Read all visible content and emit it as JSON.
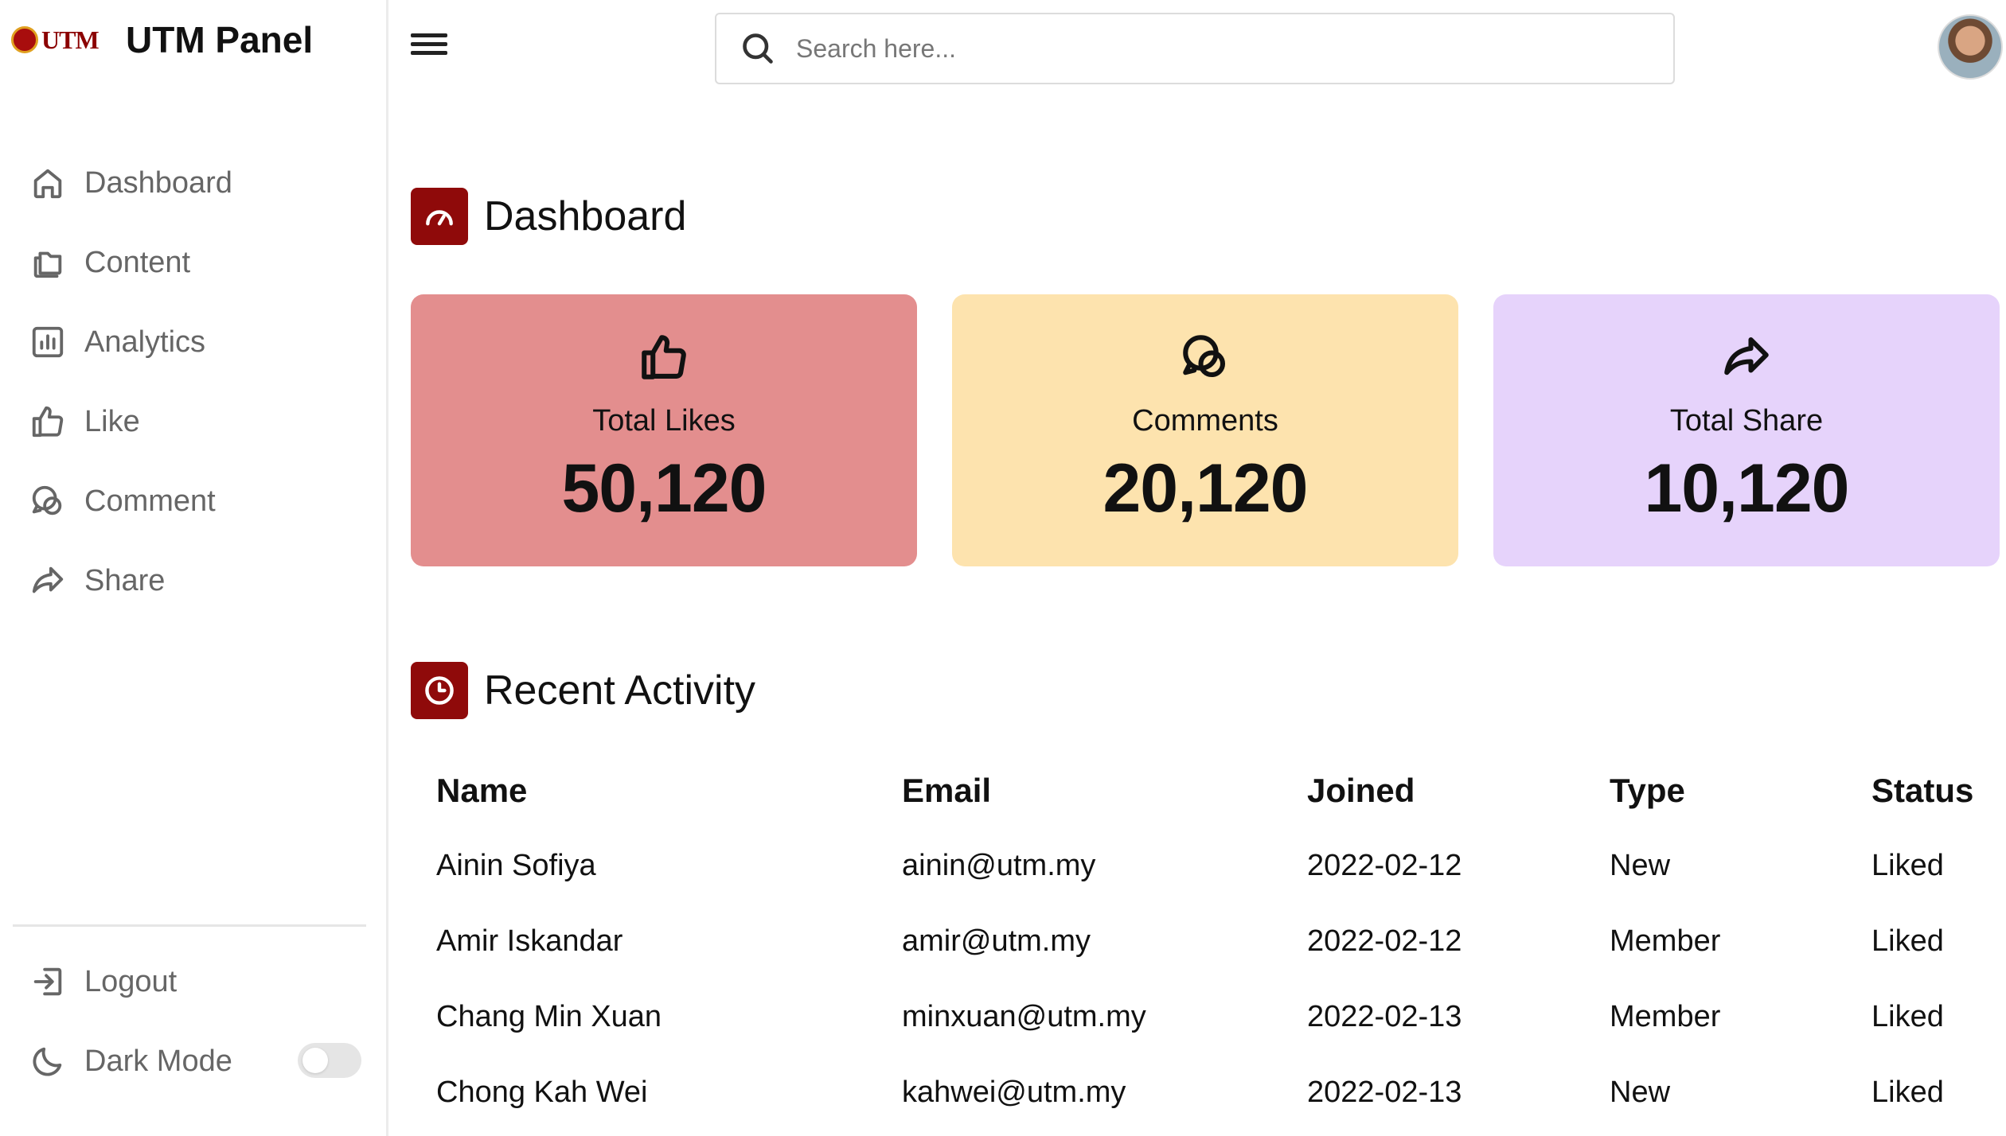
{
  "brand": {
    "logo_text": "UTM",
    "title": "UTM Panel"
  },
  "sidebar": {
    "items": [
      {
        "label": "Dashboard",
        "icon": "home-icon"
      },
      {
        "label": "Content",
        "icon": "folders-icon"
      },
      {
        "label": "Analytics",
        "icon": "bar-chart-icon"
      },
      {
        "label": "Like",
        "icon": "thumbs-up-icon"
      },
      {
        "label": "Comment",
        "icon": "chat-bubbles-icon"
      },
      {
        "label": "Share",
        "icon": "share-arrow-icon"
      }
    ],
    "bottom": [
      {
        "label": "Logout",
        "icon": "logout-icon"
      },
      {
        "label": "Dark Mode",
        "icon": "moon-icon",
        "toggle_on": false
      }
    ]
  },
  "topbar": {
    "search_placeholder": "Search here...",
    "search_icon": "search-icon",
    "menu_icon": "hamburger-menu-icon"
  },
  "dashboard": {
    "title": "Dashboard",
    "icon": "speedometer-icon",
    "cards": [
      {
        "label": "Total Likes",
        "value": "50,120",
        "icon": "thumbs-up-icon",
        "color": "#e38e8e"
      },
      {
        "label": "Comments",
        "value": "20,120",
        "icon": "chat-bubbles-icon",
        "color": "#fde3ae"
      },
      {
        "label": "Total Share",
        "value": "10,120",
        "icon": "share-arrow-icon",
        "color": "#e6d3fb"
      }
    ]
  },
  "activity": {
    "title": "Recent Activity",
    "icon": "clock-icon",
    "columns": [
      "Name",
      "Email",
      "Joined",
      "Type",
      "Status"
    ],
    "rows": [
      [
        "Ainin Sofiya",
        "ainin@utm.my",
        "2022-02-12",
        "New",
        "Liked"
      ],
      [
        "Amir Iskandar",
        "amir@utm.my",
        "2022-02-12",
        "Member",
        "Liked"
      ],
      [
        "Chang Min Xuan",
        "minxuan@utm.my",
        "2022-02-13",
        "Member",
        "Liked"
      ],
      [
        "Chong Kah Wei",
        "kahwei@utm.my",
        "2022-02-13",
        "New",
        "Liked"
      ]
    ]
  },
  "colors": {
    "accent": "#8f0a0a",
    "muted_text": "#666666"
  }
}
